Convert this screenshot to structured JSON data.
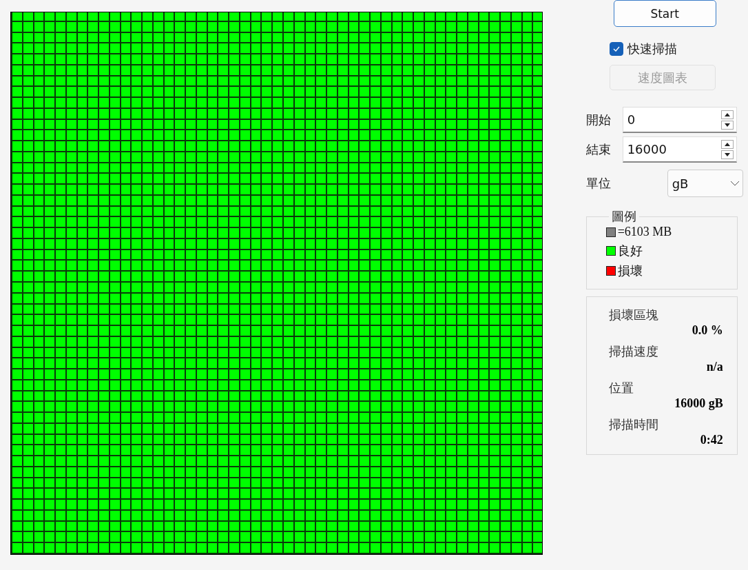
{
  "block_map": {
    "damaged": false
  },
  "start_button": {
    "label": "Start"
  },
  "quick_scan": {
    "label": "快速掃描",
    "checked": true
  },
  "speed_chart_button": {
    "label": "速度圖表",
    "disabled": true
  },
  "range": [
    {
      "label": "開始",
      "value": "0"
    },
    {
      "label": "結束",
      "value": "16000"
    }
  ],
  "unit": {
    "label": "單位",
    "value": "gB"
  },
  "legend": {
    "title": "圖例",
    "items": [
      {
        "label": "=6103 MB",
        "color": "#808080"
      },
      {
        "label": "良好",
        "color": "#00ff00"
      },
      {
        "label": "損壞",
        "color": "#ff0000"
      }
    ]
  },
  "stats": [
    {
      "label": "損壞區塊",
      "value": "0.0 %"
    },
    {
      "label": "掃描速度",
      "value": "n/a"
    },
    {
      "label": "位置",
      "value": "16000 gB"
    },
    {
      "label": "掃描時間",
      "value": "0:42"
    }
  ]
}
